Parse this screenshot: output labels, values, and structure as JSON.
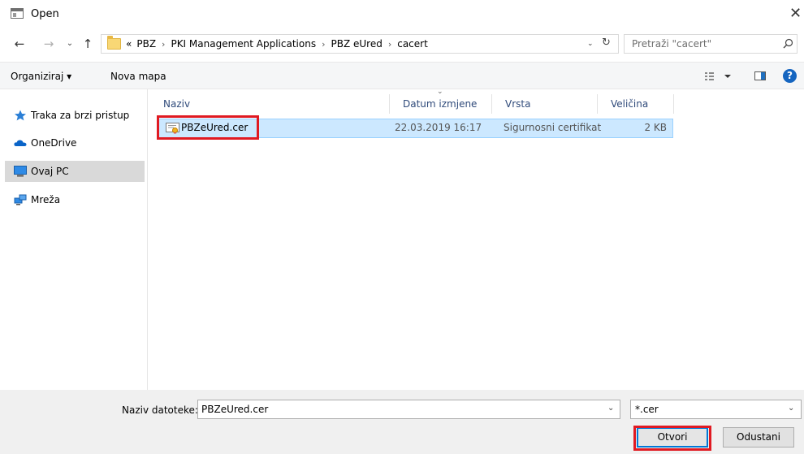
{
  "window": {
    "title": "Open",
    "close_glyph": "✕"
  },
  "nav": {
    "back_glyph": "←",
    "forward_glyph": "→",
    "recent_glyph": "⌄",
    "up_glyph": "↑"
  },
  "address": {
    "overflow": "«",
    "crumbs": [
      "PBZ",
      "PKI Management Applications",
      "PBZ eUred",
      "cacert"
    ],
    "separator": "›",
    "dropdown_glyph": "⌄",
    "refresh_glyph": "↻"
  },
  "search": {
    "placeholder": "Pretraži \"cacert\""
  },
  "toolbar": {
    "organize_label": "Organiziraj ▾",
    "newfolder_label": "Nova mapa",
    "help_label": "?"
  },
  "sidebar": {
    "items": [
      {
        "label": "Traka za brzi pristup",
        "icon": "star-icon"
      },
      {
        "label": "OneDrive",
        "icon": "cloud-icon"
      },
      {
        "label": "Ovaj PC",
        "icon": "computer-icon",
        "selected": true
      },
      {
        "label": "Mreža",
        "icon": "network-icon"
      }
    ]
  },
  "columns": {
    "name": "Naziv",
    "date": "Datum izmjene",
    "type": "Vrsta",
    "size": "Veličina",
    "sort_glyph": "⌄"
  },
  "files": [
    {
      "name": "PBZeUred.cer",
      "date": "22.03.2019 16:17",
      "type": "Sigurnosni certifikat",
      "size": "2 KB",
      "icon": "certificate-icon",
      "selected": true
    }
  ],
  "bottom": {
    "filename_label": "Naziv datoteke:",
    "filename_value": "PBZeUred.cer",
    "filter_value": "*.cer",
    "open_label": "Otvori",
    "cancel_label": "Odustani",
    "dropdown_glyph": "⌄"
  },
  "colors": {
    "highlight": "#e01a22",
    "selection": "#cce8ff",
    "accent": "#0078d7"
  }
}
